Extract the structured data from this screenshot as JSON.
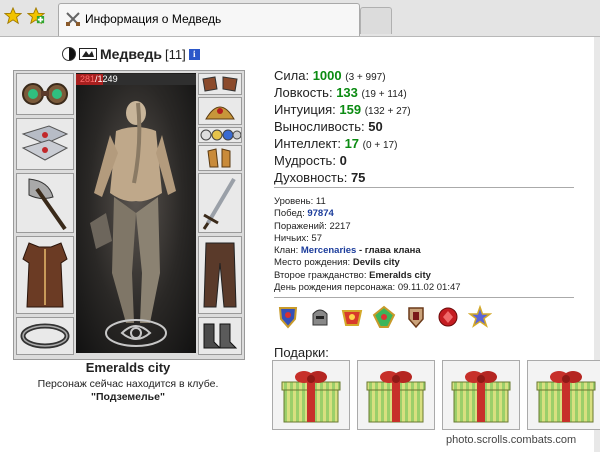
{
  "browser": {
    "tab_title": "Информация о Медведь"
  },
  "character": {
    "name": "Медведь",
    "level": "[11]",
    "info_glyph": "i",
    "hp_current": "281",
    "hp_max": "1249",
    "hp_fraction": 0.225,
    "location": "Emeralds city",
    "club_text": "Персонаж сейчас находится в клубе.",
    "club_name": "\"Подземелье\""
  },
  "stats": [
    {
      "label": "Сила:",
      "value": "1000",
      "bonus": "(3 + 997)",
      "green": true
    },
    {
      "label": "Ловкость:",
      "value": "133",
      "bonus": "(19 + 114)",
      "green": true
    },
    {
      "label": "Интуиция:",
      "value": "159",
      "bonus": "(132 + 27)",
      "green": true
    },
    {
      "label": "Выносливость:",
      "value": "50",
      "bonus": "",
      "green": false
    },
    {
      "label": "Интеллект:",
      "value": "17",
      "bonus": "(0 + 17)",
      "green": true
    },
    {
      "label": "Мудрость:",
      "value": "0",
      "bonus": "",
      "green": false
    },
    {
      "label": "Духовность:",
      "value": "75",
      "bonus": "",
      "green": false
    }
  ],
  "info": {
    "level_label": "Уровень:",
    "level_value": "11",
    "wins_label": "Побед:",
    "wins_value": "97874",
    "losses_label": "Поражений:",
    "losses_value": "2217",
    "draws_label": "Ничьих:",
    "draws_value": "57",
    "clan_label": "Клан:",
    "clan_name": "Mercenaries",
    "clan_role": " - глава клана",
    "birthplace_label": "Место рождения:",
    "birthplace_value": "Devils city",
    "citizenship_label": "Второе гражданство:",
    "citizenship_value": "Emeralds city",
    "birthday_label": "День рождения персонажа:",
    "birthday_value": "09.11.02 01:47"
  },
  "gifts": {
    "label": "Подарки:",
    "count": 4
  },
  "watermark": "photo.scrolls.combats.com",
  "colors": {
    "green_stat": "#0b8b12",
    "blue_link": "#1b3c9b",
    "hp_red": "#a8201f"
  },
  "icons": {
    "slots_left": [
      "amulet-icon",
      "bracers-icon",
      "axe-icon",
      "armor-icon",
      "belt-icon"
    ],
    "slots_right": [
      "gloves-icon",
      "helmet-icon",
      "rings-icon",
      "gauntlet-icon",
      "sword-icon",
      "leggings-icon",
      "boots-icon"
    ],
    "medals": [
      "shield-medal-icon",
      "helmet-medal-icon",
      "crest-medal-icon",
      "gem-medal-icon",
      "knight-medal-icon",
      "red-badge-icon",
      "star-medal-icon"
    ]
  }
}
